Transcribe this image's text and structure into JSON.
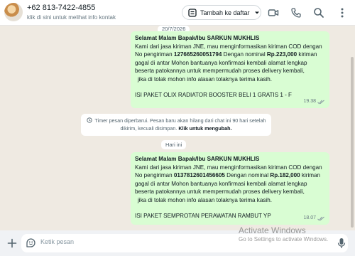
{
  "header": {
    "contact_name": "+62 813-7422-4855",
    "contact_subtitle": "klik di sini untuk melihat info kontak",
    "add_list_label": "Tambah ke daftar"
  },
  "chat": {
    "partial_date": "20/7/2026",
    "message1": {
      "lines": [
        "Selamat Malam Bapak/Ibu SARKUN MUKHLIS",
        "Kami dari jasa kiriman JNE, mau menginformasikan kiriman COD dengan",
        "No pengiriman",
        "127665260051794",
        "Dengan nominal",
        "Rp.223,000",
        "kiriman",
        "gagal di antar Mohon bantuanya konfirmasi kembali alamat lengkap",
        "beserta patokannya untuk mempermudah proses delivery kembali,",
        "jika di tolak mohon info alasan tolaknya terima kasih.",
        "ISI PAKET OLIX RADIATOR BOOSTER BELI 1 GRATIS 1 - F"
      ],
      "time": "19.38"
    },
    "system_notice": {
      "text": "Timer pesan diperbarui. Pesan baru akan hilang dari chat ini 90 hari setelah dikirim, kecuali disimpan.",
      "link": "Klik untuk mengubah."
    },
    "today_label": "Hari ini",
    "message2": {
      "lines": [
        "Selamat Malam Bapak/Ibu SARKUN MUKHLIS",
        "Kami dari jasa kiriman JNE, mau menginformasikan kiriman COD dengan",
        "No pengiriman",
        "0137812601456605",
        "Dengan nominal",
        "Rp.182,000",
        "kiriman",
        "gagal di antar Mohon bantuanya konfirmasi kembali alamat lengkap",
        "beserta patokannya untuk mempermudah proses delivery kembali,",
        "jika di tolak mohon info alasan tolaknya terima kasih.",
        "ISI PAKET SEMPROTAN PERAWATAN RAMBUT YP"
      ],
      "time": "18.07"
    }
  },
  "footer": {
    "placeholder": "Ketik pesan"
  },
  "watermark": {
    "title": "Activate Windows",
    "subtitle": "Go to Settings to activate Windows."
  },
  "colors": {
    "bubble": "#d9fdd3",
    "background": "#efeae2",
    "tick_blue": "#53bdeb"
  }
}
